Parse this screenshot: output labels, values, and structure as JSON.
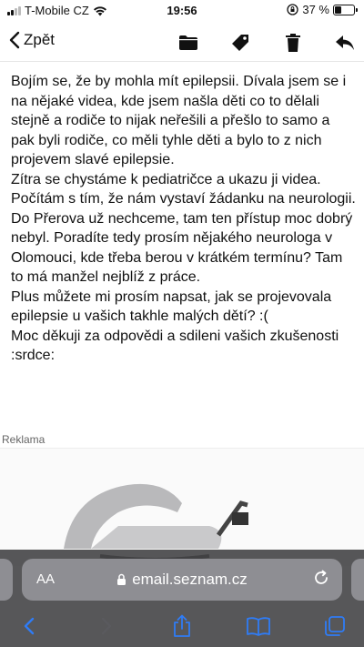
{
  "status_bar": {
    "carrier": "T-Mobile CZ",
    "time": "19:56",
    "battery_text": "37 %",
    "battery_level": 0.37
  },
  "toolbar": {
    "back_label": "Zpět",
    "icons": [
      "folder-icon",
      "tag-icon",
      "trash-icon",
      "reply-icon"
    ]
  },
  "message": {
    "partial_top_line": "...",
    "body": "Bojím se, že by mohla mít epilepsii.  Dívala jsem se i na nějaké videa, kde jsem našla děti co to dělali stejně a rodiče to nijak neřešili a přešlo to samo a pak byli rodiče, co měli tyhle děti a bylo to z nich projevem slavé epilepsie.\nZítra se chystáme k pediatričce a ukazu ji videa. Počítám s tím, že nám vystaví žádanku na neurologii. Do Přerova už nechceme, tam ten přístup moc dobrý nebyl. Poradíte tedy prosím nějakého neurologa v Olomouci, kde třeba berou v krátkém termínu? Tam to má manžel nejblíž z práce.\nPlus můžete mi prosím napsat, jak se projevovala epilepsie u vašich takhle malých dětí?  :(\nMoc děkuji za odpovědi a sdileni vašich zkušenosti  :srdce:"
  },
  "ad": {
    "label": "Reklama"
  },
  "browser": {
    "aa_label": "AA",
    "url": "email.seznam.cz"
  }
}
